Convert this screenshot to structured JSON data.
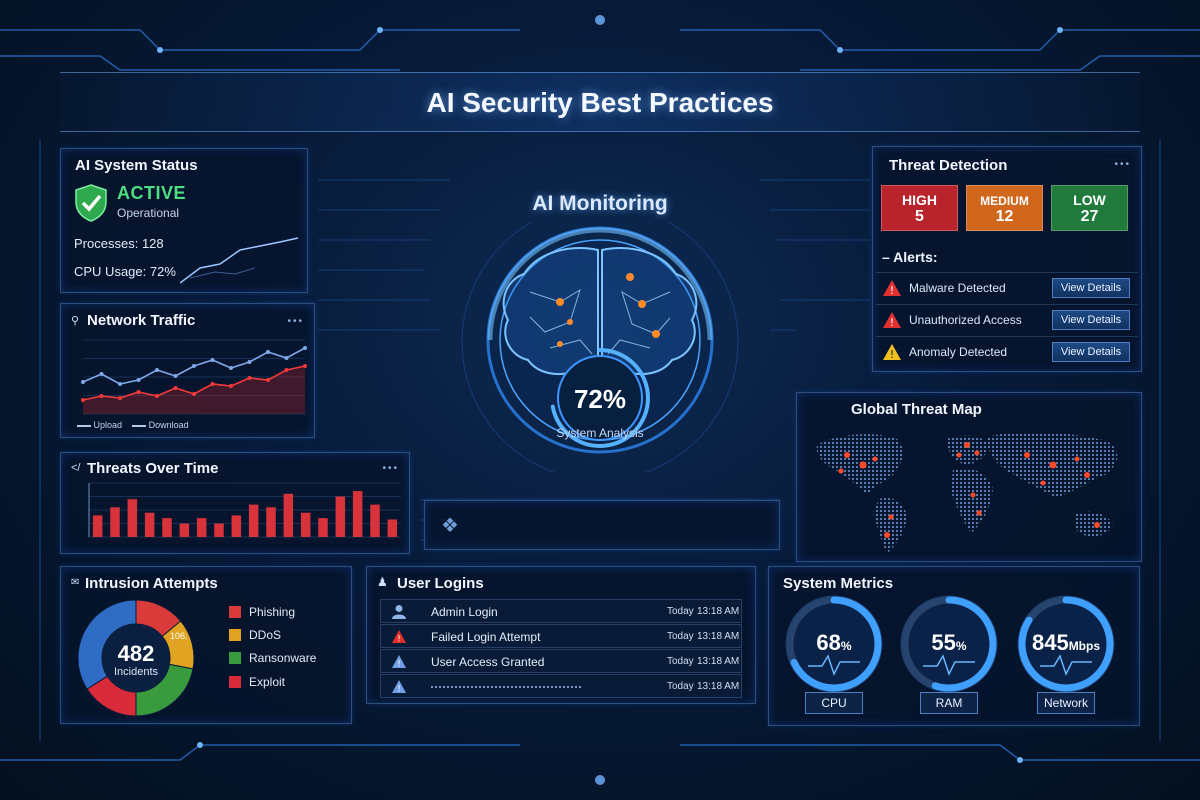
{
  "header": {
    "title": "AI Security Best Practices"
  },
  "system_status": {
    "title": "AI System Status",
    "state": "ACTIVE",
    "state_sub": "Operational",
    "processes_label": "Processes:",
    "processes_value": "128",
    "cpu_label": "CPU Usage:",
    "cpu_value": "72%",
    "colors": {
      "active": "#4ee080"
    },
    "icon": "shield-check-icon"
  },
  "network_traffic": {
    "title": "Network Traffic",
    "legend": [
      "Upload",
      "Download"
    ],
    "chart_data": {
      "type": "line",
      "series": [
        {
          "name": "Upload",
          "values": [
            3.1,
            3.5,
            3.0,
            3.2,
            3.7,
            3.4,
            3.9,
            4.2,
            3.8,
            4.1,
            4.6,
            4.3,
            4.8
          ]
        },
        {
          "name": "Download",
          "values": [
            2.2,
            2.4,
            2.3,
            2.6,
            2.4,
            2.8,
            2.5,
            3.0,
            2.9,
            3.3,
            3.2,
            3.7,
            3.9
          ]
        }
      ]
    }
  },
  "threats_over_time": {
    "title": "Threats Over Time",
    "chart_data": {
      "type": "bar",
      "values": [
        16,
        22,
        28,
        18,
        14,
        10,
        14,
        10,
        16,
        24,
        22,
        32,
        18,
        14,
        30,
        34,
        24,
        13
      ],
      "ylim": [
        0,
        40
      ]
    }
  },
  "ai_monitoring": {
    "title": "AI Monitoring",
    "percent": "72%",
    "progress": 0.72,
    "subtitle": "System Analysis",
    "icon": "brain-icon"
  },
  "threat_detection": {
    "title": "Threat Detection",
    "levels": [
      {
        "label": "HIGH",
        "count": "5",
        "color": "#b8232c"
      },
      {
        "label": "MEDIUM",
        "count": "12",
        "color": "#d0671c"
      },
      {
        "label": "LOW",
        "count": "27",
        "color": "#1f7a3c"
      }
    ],
    "alerts_title": "Alerts:",
    "alerts": [
      {
        "text": "Malware Detected",
        "button": "View Details",
        "icon": "warning-red-icon"
      },
      {
        "text": "Unauthorized Access",
        "button": "View Details",
        "icon": "warning-red-icon"
      },
      {
        "text": "Anomaly Detected",
        "button": "View Details",
        "icon": "warning-yellow-icon"
      }
    ]
  },
  "global_threat_map": {
    "title": "Global Threat Map",
    "icon": "world-map-icon"
  },
  "intrusion_attempts": {
    "title": "Intrusion Attempts",
    "total": "482",
    "total_label": "Incidents",
    "inner_label": "106.",
    "legend": [
      {
        "name": "Phishing",
        "color": "#d93a3a"
      },
      {
        "name": "DDoS",
        "color": "#e0a422"
      },
      {
        "name": "Ransonware",
        "color": "#3a9b3e"
      },
      {
        "name": "Exploit",
        "color": "#d92a3a"
      }
    ],
    "chart_data": {
      "type": "pie",
      "slices": [
        {
          "name": "Phishing",
          "value": 14
        },
        {
          "name": "DDoS",
          "value": 14
        },
        {
          "name": "Ransonware",
          "value": 22
        },
        {
          "name": "Exploit",
          "value": 16
        }
      ],
      "other_color": "#2f6cc4"
    }
  },
  "user_logins": {
    "title": "User Logins",
    "rows": [
      {
        "label": "Admin Login",
        "day": "Today",
        "time": "13:18 AM",
        "icon": "user-icon"
      },
      {
        "label": "Failed Login Attempt",
        "day": "Today",
        "time": "13:18 AM",
        "icon": "warning-red-icon"
      },
      {
        "label": "User Access Granted",
        "day": "Today",
        "time": "13:18 AM",
        "icon": "warning-blue-icon"
      },
      {
        "label": "",
        "day": "Today",
        "time": "13:18 AM",
        "icon": "warning-blue-icon"
      }
    ]
  },
  "system_metrics": {
    "title": "System Metrics",
    "gauges": [
      {
        "label": "CPU",
        "value": "68",
        "unit": "%",
        "level": 0.68
      },
      {
        "label": "RAM",
        "value": "55",
        "unit": "%",
        "level": 0.55
      },
      {
        "label": "Network",
        "value": "845",
        "unit": "Mbps",
        "level": 0.84
      }
    ]
  }
}
